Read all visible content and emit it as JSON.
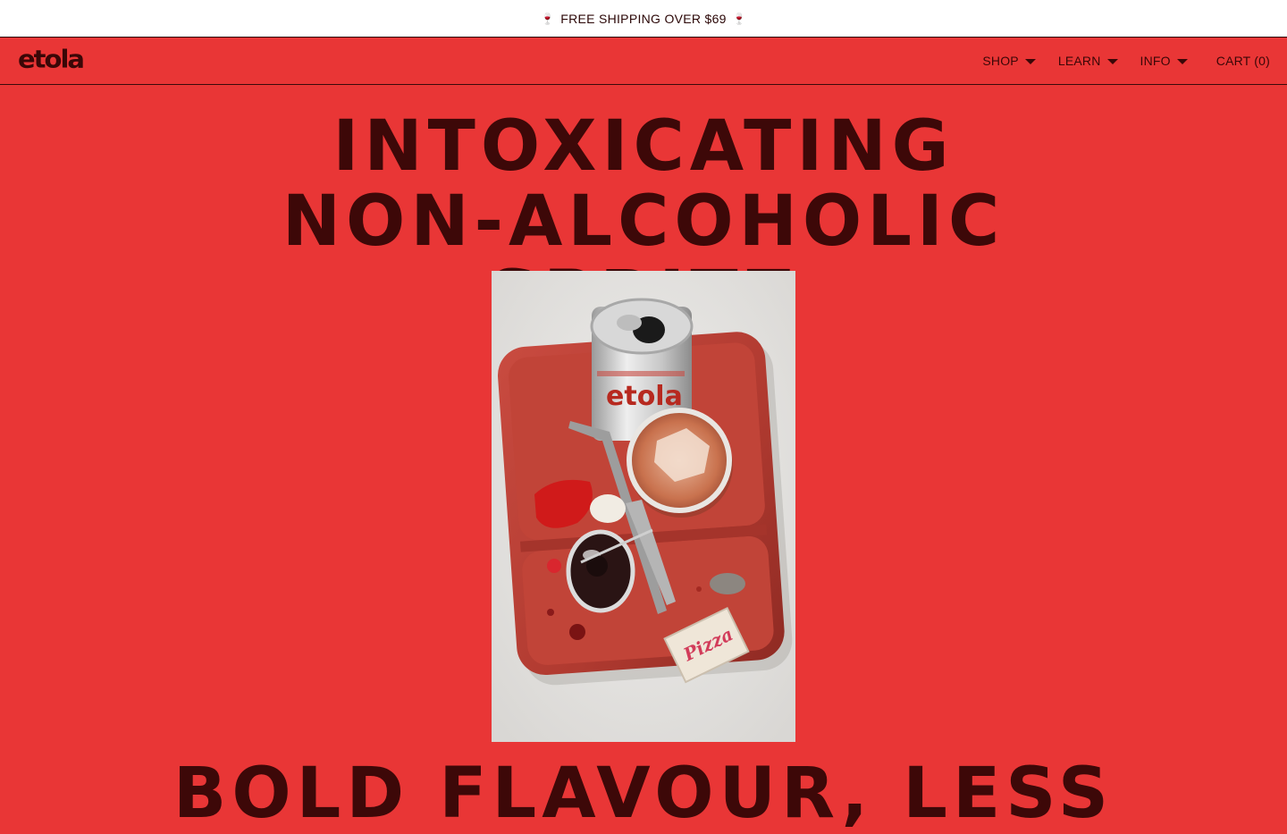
{
  "announcement": {
    "text": "FREE SHIPPING OVER $69",
    "icon": "wine-glass-icon"
  },
  "nav": {
    "logo": "etola",
    "items": [
      {
        "label": "SHOP"
      },
      {
        "label": "LEARN"
      },
      {
        "label": "INFO"
      }
    ],
    "cart_label": "CART (0)"
  },
  "hero": {
    "title": "INTOXICATING NON-ALCOHOLIC SPRITZ",
    "subtitle": "BOLD FLAVOUR, LESS"
  },
  "colors": {
    "background": "#e93636",
    "text": "#3d0808",
    "announce_bg": "#ffffff"
  }
}
